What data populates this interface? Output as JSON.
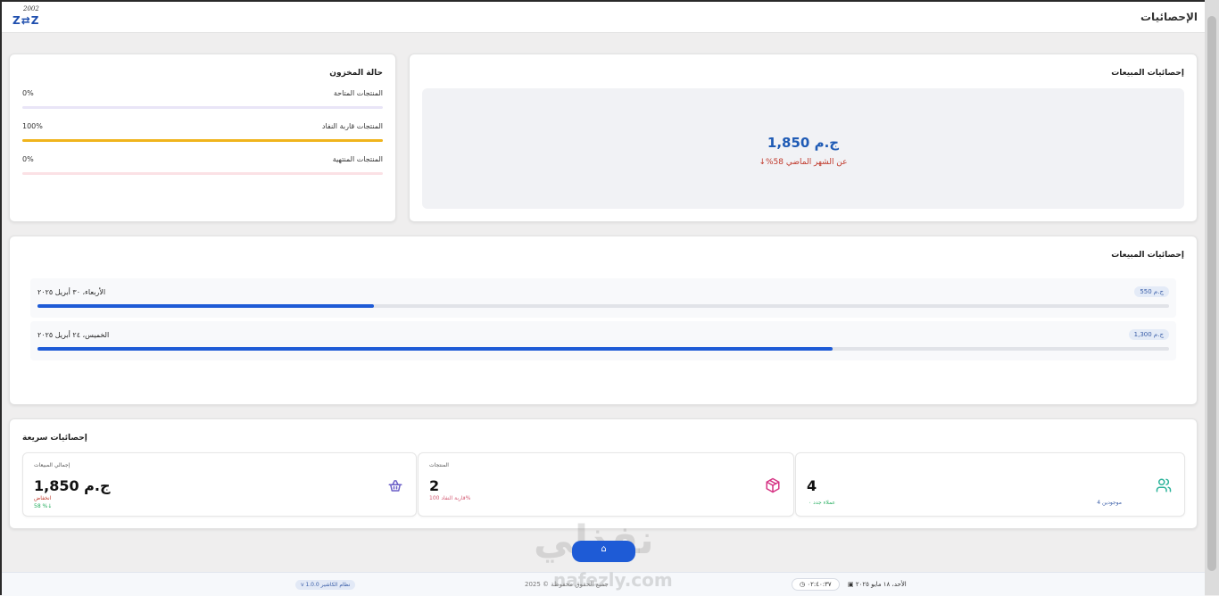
{
  "header": {
    "title": "الإحصائيات",
    "logo_top": "2002",
    "logo_main": "Z⇄Z"
  },
  "inventory": {
    "title": "حالة المخزون",
    "rows": [
      {
        "label": "المنتجات المتاحة",
        "pct_text": "0%",
        "fill": 0,
        "color": "#ddd6f3"
      },
      {
        "label": "المنتجات قاربة النفاد",
        "pct_text": "100%",
        "fill": 1.0,
        "color": "#f0b41c"
      },
      {
        "label": "المنتجات المنتهية",
        "pct_text": "0%",
        "fill": 0,
        "color": "#f9dbe0"
      }
    ]
  },
  "sales_summary": {
    "title": "إحصائيات المبيعات",
    "amount": "ج.م 1,850",
    "compare": "عن الشهر الماضي 58%↓"
  },
  "daily_sales": {
    "title": "إحصائيات المبيعات",
    "rows": [
      {
        "label": "الأربعاء، ٣٠ أبريل ٢٠٢٥",
        "badge": "ج.م 550",
        "fill": 0.297
      },
      {
        "label": "الخميس، ٢٤ أبريل ٢٠٢٥",
        "badge": "ج.م 1,300",
        "fill": 0.703
      }
    ]
  },
  "quick_stats": {
    "title": "إحصائيات سريعة",
    "cards": [
      {
        "label": "إجمالي المبيعات",
        "value": "ج.م 1,850",
        "sub1": "انخفاض",
        "sub2": "58 %↓",
        "icon": "basket-icon"
      },
      {
        "label": "المنتجات",
        "value": "2",
        "sub1": "قاربة النفاد 100%",
        "icon": "box-icon"
      },
      {
        "label": "",
        "value": "4",
        "sub_a": "عملاء جدد ٠",
        "sub_b": "موجودين 4",
        "icon": "users-icon"
      }
    ]
  },
  "center_button": {
    "label": "⌂"
  },
  "footer": {
    "date": "الأحد، ١٨ مايو ٢٠٢٥",
    "time": "٠٢:٤٠:٣٧",
    "copyright": "جميع الحقوق محفوظة © 2025",
    "version": "v 1.0.0 نظام الكاشير"
  },
  "watermark": {
    "text": "نفذلي",
    "url": "nafezly.com"
  },
  "colors": {
    "accent": "#1e5bd6",
    "amount": "#1f5bb5",
    "down": "#c0392b",
    "up": "#27ae60"
  }
}
